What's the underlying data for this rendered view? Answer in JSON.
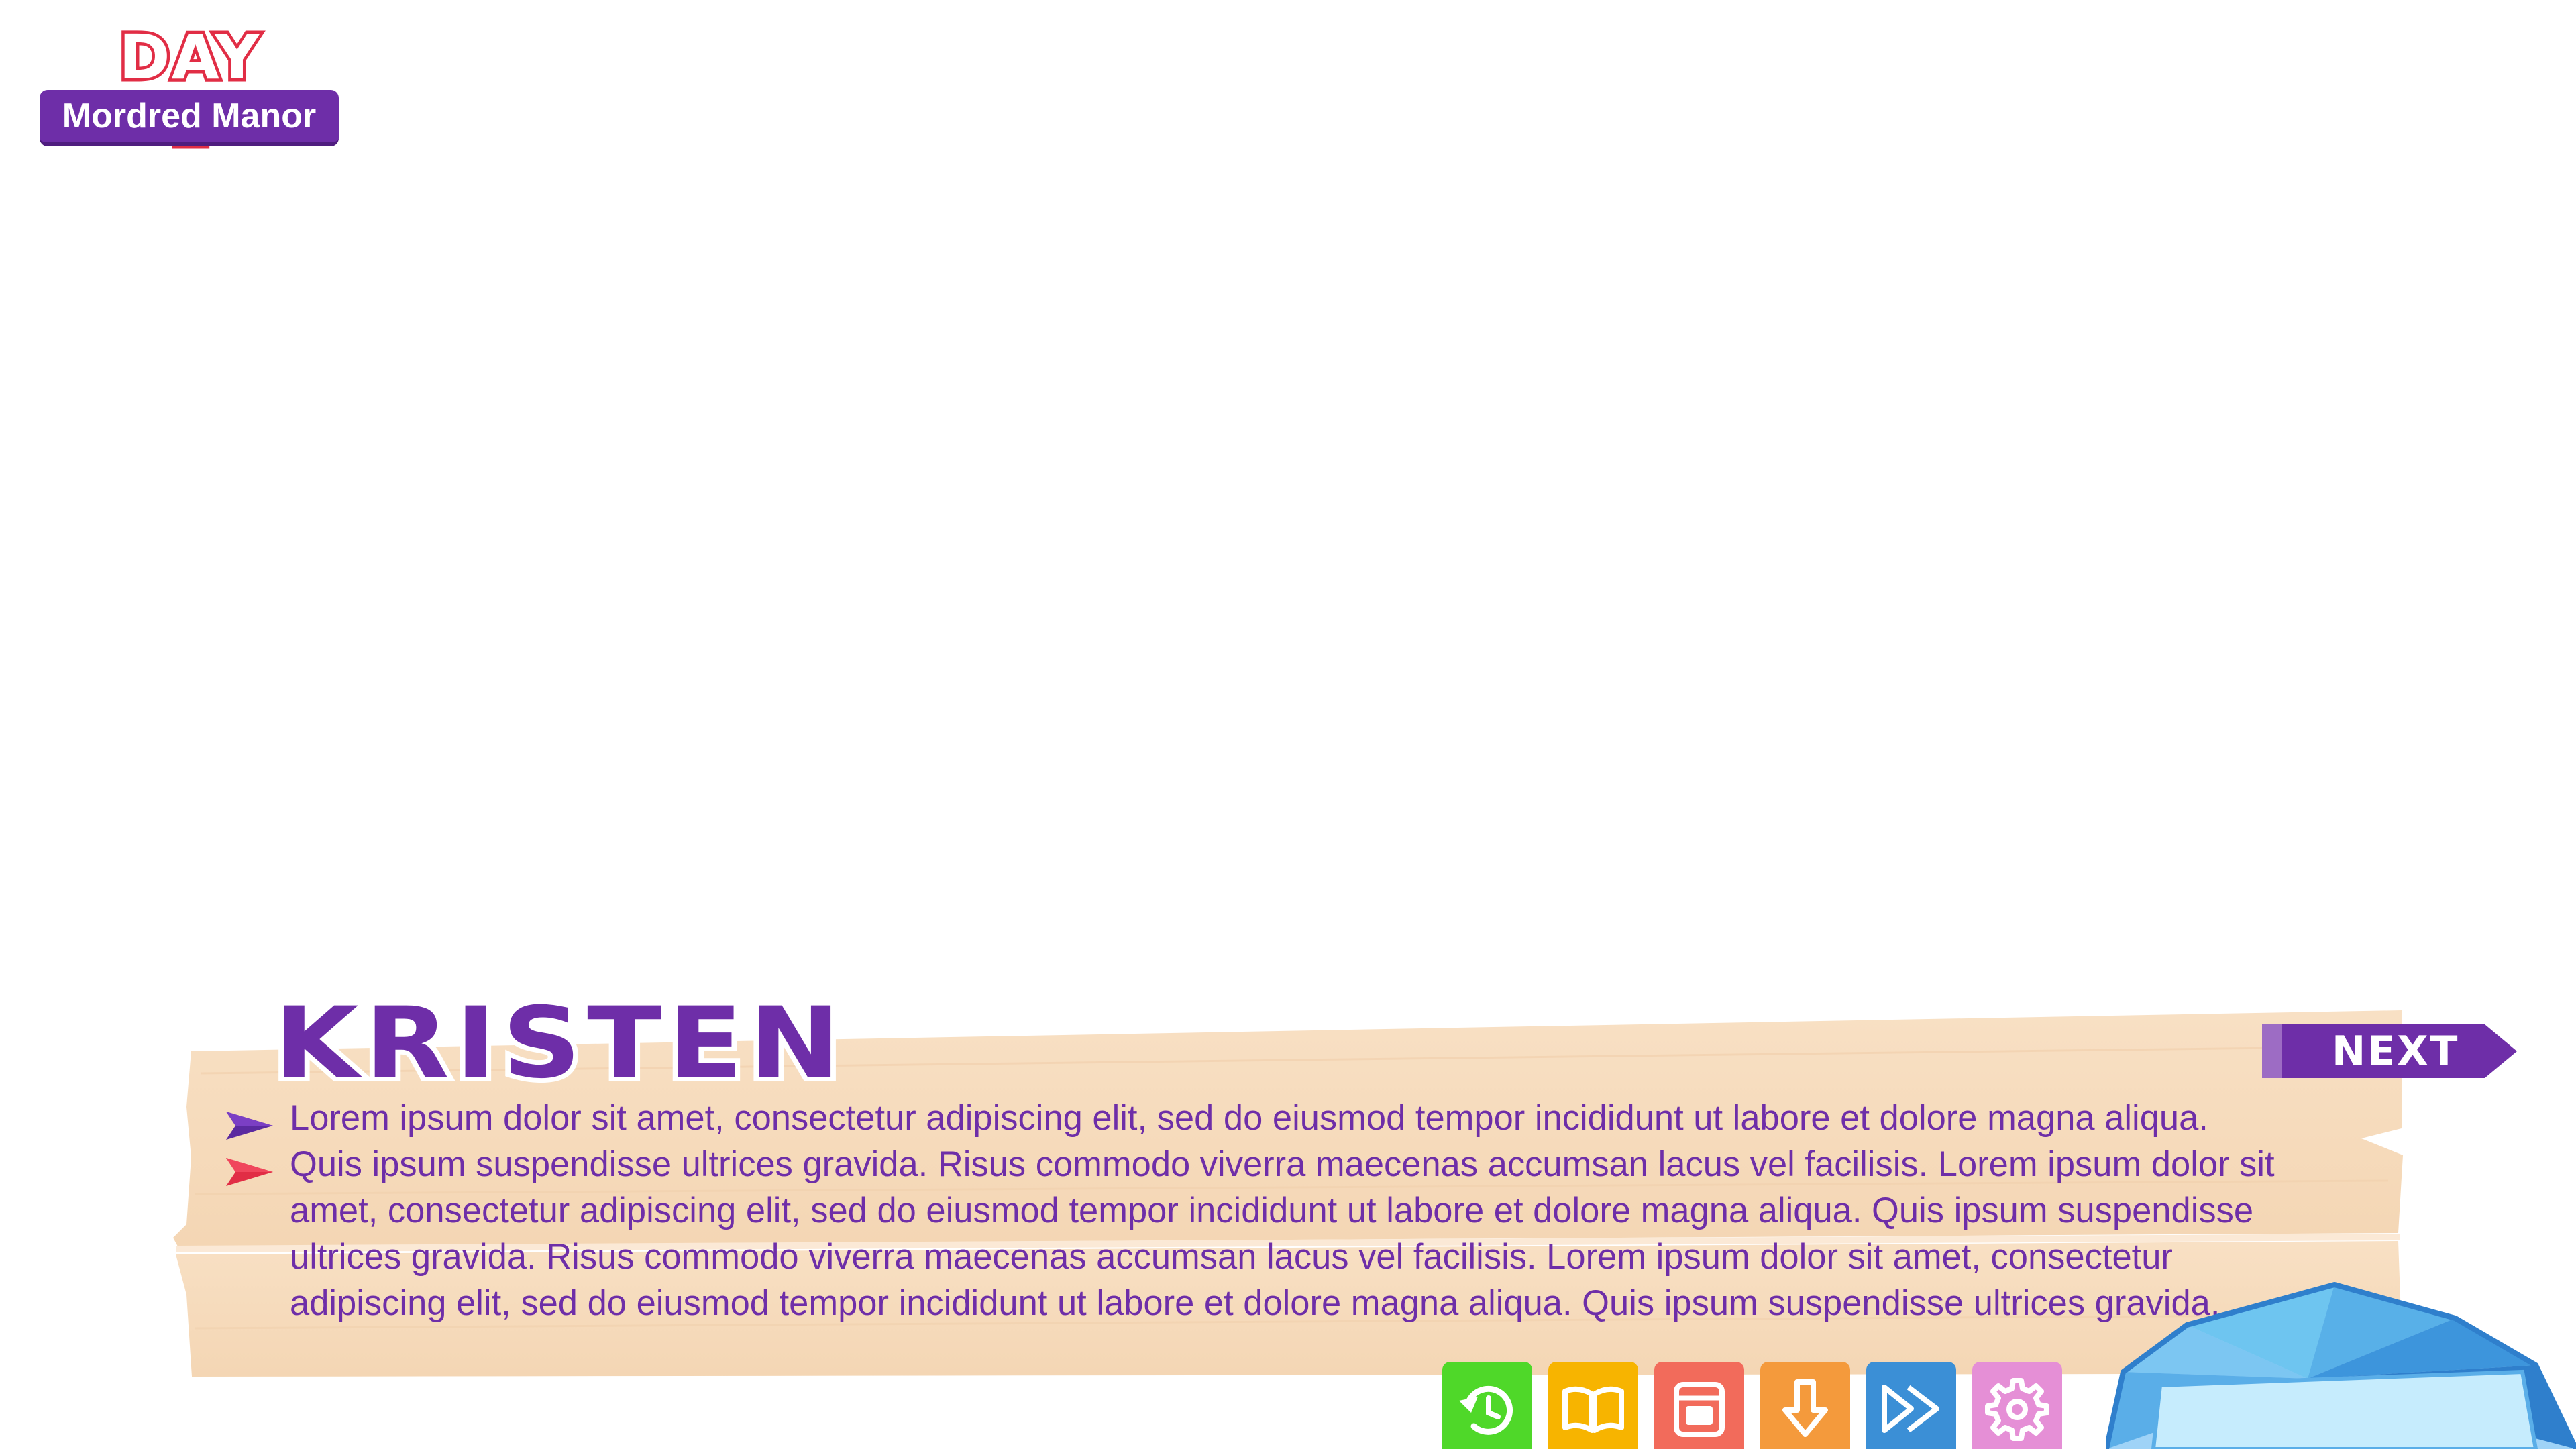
{
  "hud": {
    "day": "DAY 1",
    "location": "Mordred Manor"
  },
  "dialogue": {
    "speaker": "KRISTEN",
    "text": "Lorem ipsum dolor sit amet, consectetur adipiscing elit, sed do eiusmod tempor incididunt ut labore et dolore magna aliqua. Quis ipsum suspendisse ultrices gravida. Risus commodo viverra maecenas accumsan lacus vel facilisis. Lorem ipsum dolor sit amet, consectetur adipiscing elit, sed do eiusmod tempor incididunt ut labore et dolore magna aliqua. Quis ipsum suspendisse ultrices gravida. Risus commodo viverra maecenas accumsan lacus vel facilisis. Lorem ipsum dolor sit amet, consectetur adipiscing elit, sed do eiusmod tempor incididunt ut labore et dolore magna aliqua. Quis ipsum suspendisse ultrices gravida."
  },
  "next_button": {
    "label": "NEXT"
  },
  "quick_menu": [
    {
      "name": "rollback",
      "icon": "rollback-icon",
      "color": "#4fd829"
    },
    {
      "name": "history",
      "icon": "book-icon",
      "color": "#f7b400"
    },
    {
      "name": "window",
      "icon": "window-icon",
      "color": "#f26b5b"
    },
    {
      "name": "save",
      "icon": "download-arrow-icon",
      "color": "#f49a3c"
    },
    {
      "name": "skip",
      "icon": "fast-forward-icon",
      "color": "#3b8fd6"
    },
    {
      "name": "settings",
      "icon": "gear-icon",
      "color": "#e58fd6"
    }
  ],
  "colors": {
    "purple": "#6e2ea8",
    "red": "#e12d45",
    "wood": "#f6dcbd"
  }
}
